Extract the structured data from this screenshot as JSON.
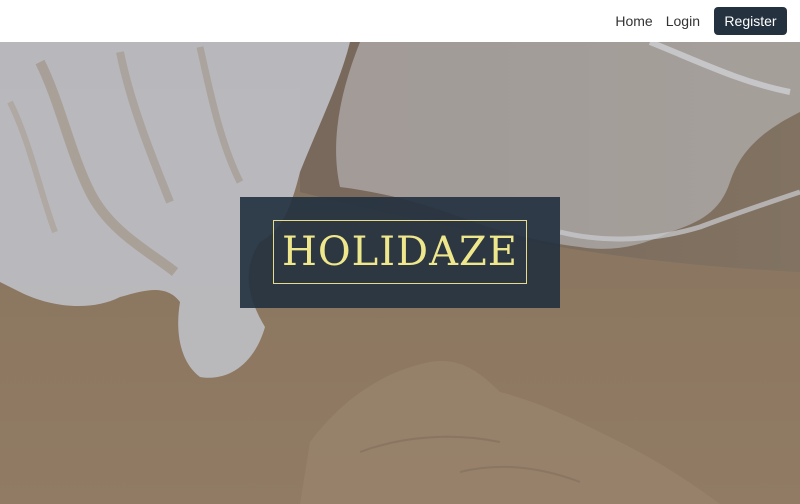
{
  "nav": {
    "home_label": "Home",
    "login_label": "Login",
    "register_label": "Register"
  },
  "hero": {
    "title": "HOLIDAZE"
  },
  "colors": {
    "brand_dark": "#243240",
    "title_gold": "#efe78c",
    "sand": "#a88b6c",
    "foam": "#e6e6ea"
  }
}
